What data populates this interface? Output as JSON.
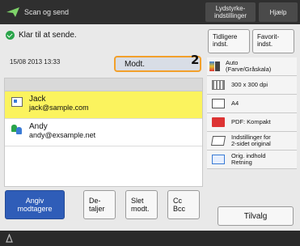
{
  "header": {
    "app_title": "Scan og send",
    "status_monitor_label": "Lydstyrke-\nindstillinger",
    "help_label": "Hjælp"
  },
  "status": {
    "message": "Klar til at sende."
  },
  "datetime": "15/08 2013 13:33",
  "recipient_mode": {
    "value": "Modt.",
    "callout": "2"
  },
  "recipients": [
    {
      "name": "Jack",
      "address": "jack@sample.com",
      "icon": "address-card-icon",
      "selected": true
    },
    {
      "name": "Andy",
      "address": "andy@exsample.net",
      "icon": "group-icon",
      "selected": false
    }
  ],
  "actions": {
    "specify_recipients": "Angiv\nmodtagere",
    "details": "De-\ntaljer",
    "delete_recipient": "Slet\nmodt.",
    "cc_bcc": "Cc\nBcc"
  },
  "side_panel": {
    "previous_settings": "Tidligere\nindst.",
    "favorite_settings": "Favorit-\nindst.",
    "settings": [
      {
        "key": "color",
        "label": "Auto\n(Farve/Gråskala)",
        "icon": "color-mode-icon"
      },
      {
        "key": "resolution",
        "label": "300 x 300 dpi",
        "icon": "resolution-icon"
      },
      {
        "key": "size",
        "label": "A4",
        "icon": "paper-size-icon"
      },
      {
        "key": "format",
        "label": "PDF: Kompakt",
        "icon": "pdf-icon"
      },
      {
        "key": "duplex",
        "label": "Indstillinger for\n2-sidet original",
        "icon": "duplex-icon"
      },
      {
        "key": "orientation",
        "label": "Orig. indhold\nRetning",
        "icon": "orientation-icon"
      }
    ],
    "options_label": "Tilvalg"
  },
  "colors": {
    "accent": "#2f5db8",
    "selected_row": "#fbf35e",
    "highlight_border": "#f2a02b",
    "ok": "#2aa44a"
  }
}
